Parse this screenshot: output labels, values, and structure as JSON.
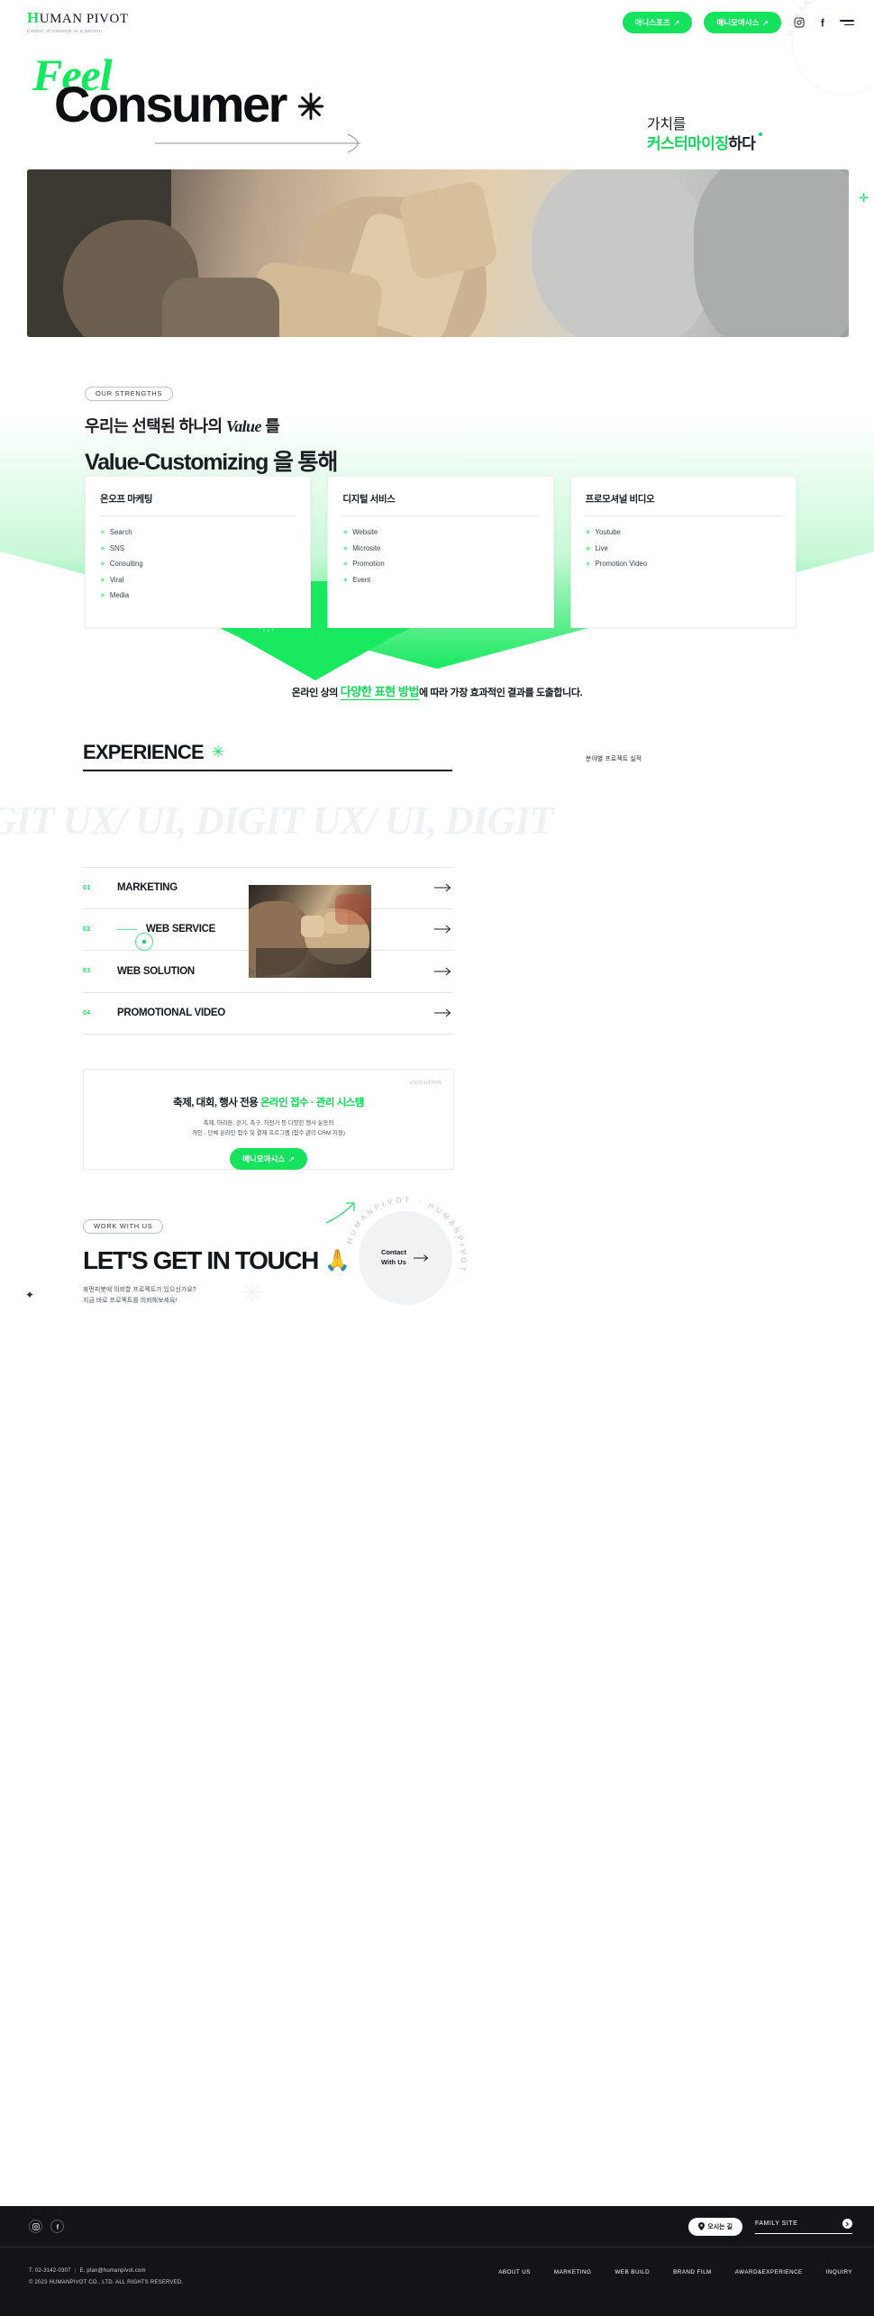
{
  "brand": {
    "name_h": "H",
    "name_rest": "UMAN PIVOT",
    "tagline": "Center of network is a person"
  },
  "header": {
    "btn_sports": "애니스포츠",
    "btn_moasys": "애니모아시스",
    "ext_icon": "↗",
    "instagram_icon": "instagram-icon",
    "facebook_icon": "facebook-icon",
    "menu_icon": "hamburger-menu-icon",
    "circle_text": "HUMANPIVOT · HUMANPIVOT · "
  },
  "hero": {
    "word_feel": "Feel",
    "word_consumer": "Consumer",
    "star_icon": "asterisk-icon",
    "kr_line1": "가치를",
    "kr_line2_green": "커스터마이징",
    "kr_line2_black": "하다",
    "arrow_icon": "long-arrow-right-icon"
  },
  "strengths": {
    "badge": "OUR STRENGTHS",
    "line1_a": "우리는 선택된 하나의 ",
    "line1_em": "Value",
    "line1_b": " 를",
    "line2": "Value-Customizing 을 통해",
    "cards": [
      {
        "title": "온오프 마케팅",
        "items": [
          "Search",
          "SNS",
          "Consulting",
          "Viral",
          "Media"
        ]
      },
      {
        "title": "디지털 서비스",
        "items": [
          "Website",
          "Microsite",
          "Promotion",
          "Event"
        ]
      },
      {
        "title": "프로모셔널 비디오",
        "items": [
          "Youtube",
          "Live",
          "Promotion Video"
        ]
      }
    ],
    "tagline_a": "온라인 상의 ",
    "tagline_hl": "다양한 표현 방법",
    "tagline_b": "에 따라 가장 효과적인 결과를 도출합니다."
  },
  "experience": {
    "title": "EXPERIENCE",
    "title_mark": "✳",
    "subtitle": "분야별 프로젝트 실적",
    "marquee": "DIGIT UX/ UI, DIGIT UX/ UI, DIGIT",
    "rows": [
      {
        "num": "01",
        "name": "MARKETING",
        "active": false
      },
      {
        "num": "02",
        "name": "WEB SERVICE",
        "active": true
      },
      {
        "num": "03",
        "name": "WEB SOLUTION",
        "active": false
      },
      {
        "num": "04",
        "name": "PROMOTIONAL VIDEO",
        "active": false
      }
    ]
  },
  "solution": {
    "tag": "#SOLUTION",
    "title_a": "축제, 대회, 행사 전용 ",
    "title_g": "온라인 접수 · 관리 시스템",
    "desc1": "축제, 마라톤, 걷기, 축구, 자전거 등 다양한 행사 운동의",
    "desc2": "개인 · 단체 온라인 접수 및 결제 프로그램 (접수 관리 CRM 지원)",
    "button": "애니모아시스"
  },
  "contact": {
    "badge": "WORK WITH US",
    "title": "LET'S GET IN TOUCH",
    "emoji": "🙏",
    "sub1": "휴먼피봇에 의뢰할 프로젝트가 있으신가요?",
    "sub2": "지금 바로 프로젝트를 의뢰해보세요!",
    "circle_line1": "Contact",
    "circle_line2": "With Us",
    "circle_arrow": "→",
    "ring_text": "HUMANPIVOT · HUMANPIVOT · "
  },
  "footer": {
    "instagram_icon": "instagram-icon",
    "facebook_icon": "facebook-icon",
    "map_label": "오시는 길",
    "map_pin_icon": "map-pin-icon",
    "family_site": "FAMILY SITE",
    "family_arrow": "›",
    "tel": "T. 02-3142-0307",
    "email": "E. plan@humanpivot.com",
    "copyright": "© 2023 HUMANPIVOT CO., LTD. ALL RIGHTS RESERVED.",
    "nav": [
      "ABOUT US",
      "MARKETING",
      "WEB BUILD",
      "BRAND FILM",
      "AWARD&EXPERIENCE",
      "INQUIRY"
    ]
  },
  "colors": {
    "accent": "#15e35e",
    "accent_dark": "#10d957",
    "ink": "#16191c",
    "footer_bg": "#121417"
  }
}
